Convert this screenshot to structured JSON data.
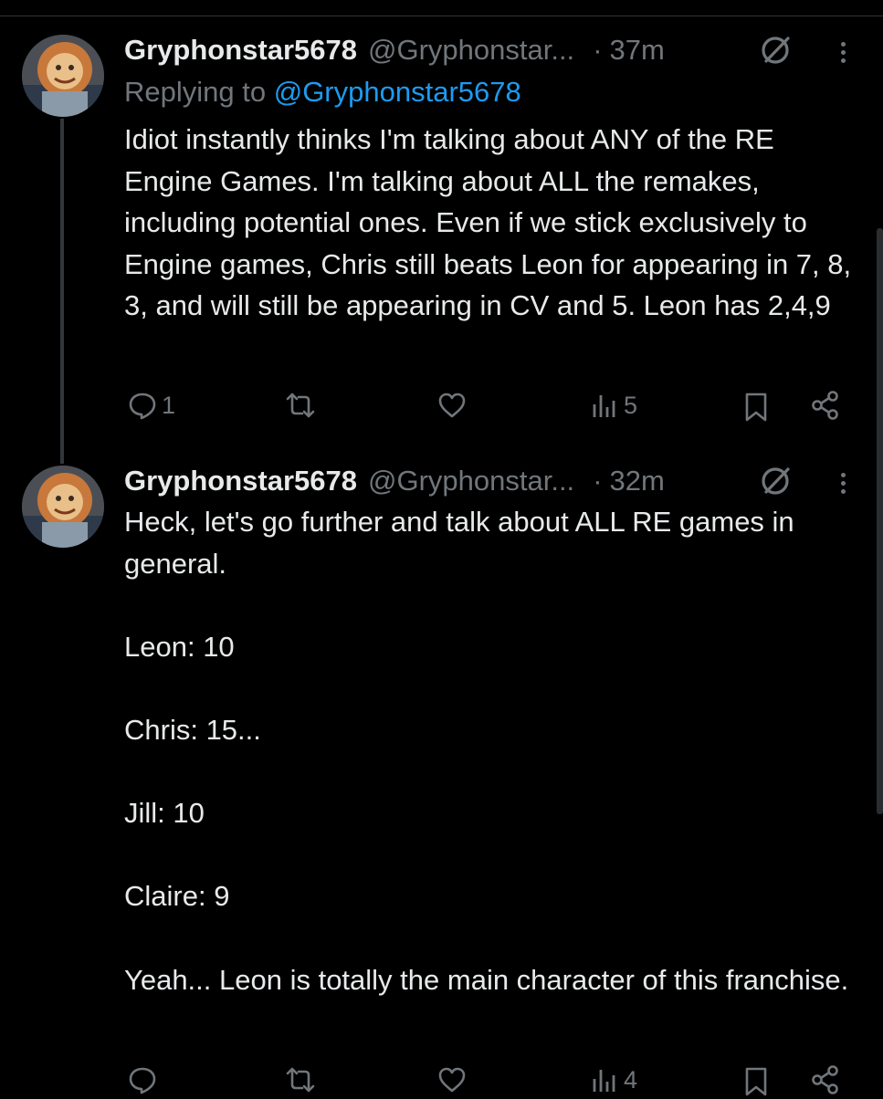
{
  "tweets": [
    {
      "display_name": "Gryphonstar5678",
      "handle": "@Gryphonstar...",
      "time": "37m",
      "replying_label": "Replying to",
      "replying_handle": "@Gryphonstar5678",
      "text": "Idiot instantly thinks I'm talking about ANY of the RE Engine Games. I'm talking about ALL the remakes, including potential ones. Even if we stick exclusively to Engine games, Chris still beats Leon for appearing in 7, 8, 3, and will still be appearing in CV and 5. Leon has 2,4,9",
      "counts": {
        "replies": "1",
        "views": "5"
      }
    },
    {
      "display_name": "Gryphonstar5678",
      "handle": "@Gryphonstar...",
      "time": "32m",
      "text": "Heck, let's go further and talk about ALL RE games in general.\n\nLeon: 10\n\nChris: 15...\n\nJill: 10\n\nClaire: 9\n\nYeah... Leon is totally the main character of this franchise.",
      "counts": {
        "views": "4"
      }
    }
  ],
  "icons": [
    "reply-icon",
    "retweet-icon",
    "like-icon",
    "views-icon",
    "bookmark-icon",
    "share-icon",
    "grok-icon",
    "more-icon"
  ],
  "colors": {
    "background": "#000000",
    "text": "#e7e9ea",
    "muted": "#71767b",
    "link": "#1d9bf0",
    "divider": "#2f3336"
  }
}
